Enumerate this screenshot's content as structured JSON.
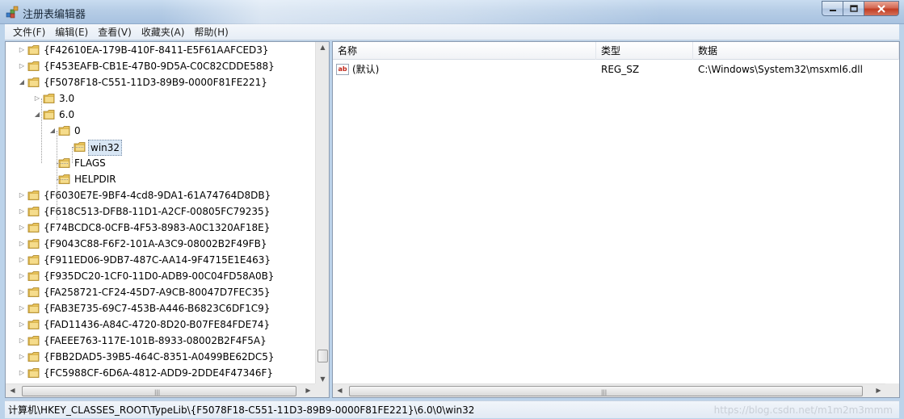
{
  "window": {
    "title": "注册表编辑器"
  },
  "menu": [
    "文件(F)",
    "编辑(E)",
    "查看(V)",
    "收藏夹(A)",
    "帮助(H)"
  ],
  "tree": [
    {
      "label": "{F42610EA-179B-410F-8411-E5F61AAFCED3}",
      "level": 0,
      "expander": "collapsed",
      "selected": false
    },
    {
      "label": "{F453EAFB-CB1E-47B0-9D5A-C0C82CDDE588}",
      "level": 0,
      "expander": "collapsed",
      "selected": false
    },
    {
      "label": "{F5078F18-C551-11D3-89B9-0000F81FE221}",
      "level": 0,
      "expander": "expanded",
      "selected": false
    },
    {
      "label": "3.0",
      "level": 1,
      "expander": "collapsed",
      "selected": false
    },
    {
      "label": "6.0",
      "level": 1,
      "expander": "expanded",
      "selected": false
    },
    {
      "label": "0",
      "level": 2,
      "expander": "expanded",
      "selected": false
    },
    {
      "label": "win32",
      "level": 3,
      "expander": "none",
      "selected": true
    },
    {
      "label": "FLAGS",
      "level": 2,
      "expander": "none",
      "selected": false
    },
    {
      "label": "HELPDIR",
      "level": 2,
      "expander": "none",
      "selected": false
    },
    {
      "label": "{F6030E7E-9BF4-4cd8-9DA1-61A74764D8DB}",
      "level": 0,
      "expander": "collapsed",
      "selected": false
    },
    {
      "label": "{F618C513-DFB8-11D1-A2CF-00805FC79235}",
      "level": 0,
      "expander": "collapsed",
      "selected": false
    },
    {
      "label": "{F74BCDC8-0CFB-4F53-8983-A0C1320AF18E}",
      "level": 0,
      "expander": "collapsed",
      "selected": false
    },
    {
      "label": "{F9043C88-F6F2-101A-A3C9-08002B2F49FB}",
      "level": 0,
      "expander": "collapsed",
      "selected": false
    },
    {
      "label": "{F911ED06-9DB7-487C-AA14-9F4715E1E463}",
      "level": 0,
      "expander": "collapsed",
      "selected": false
    },
    {
      "label": "{F935DC20-1CF0-11D0-ADB9-00C04FD58A0B}",
      "level": 0,
      "expander": "collapsed",
      "selected": false
    },
    {
      "label": "{FA258721-CF24-45D7-A9CB-80047D7FEC35}",
      "level": 0,
      "expander": "collapsed",
      "selected": false
    },
    {
      "label": "{FAB3E735-69C7-453B-A446-B6823C6DF1C9}",
      "level": 0,
      "expander": "collapsed",
      "selected": false
    },
    {
      "label": "{FAD11436-A84C-4720-8D20-B07FE84FDE74}",
      "level": 0,
      "expander": "collapsed",
      "selected": false
    },
    {
      "label": "{FAEEE763-117E-101B-8933-08002B2F4F5A}",
      "level": 0,
      "expander": "collapsed",
      "selected": false
    },
    {
      "label": "{FBB2DAD5-39B5-464C-8351-A0499BE62DC5}",
      "level": 0,
      "expander": "collapsed",
      "selected": false
    },
    {
      "label": "{FC5988CF-6D6A-4812-ADD9-2DDE4F47346F}",
      "level": 0,
      "expander": "collapsed",
      "selected": false
    }
  ],
  "list": {
    "columns": [
      "名称",
      "类型",
      "数据"
    ],
    "rows": [
      {
        "icon": "string-value-icon",
        "icon_text": "ab",
        "name": "(默认)",
        "type": "REG_SZ",
        "data": "C:\\Windows\\System32\\msxml6.dll"
      }
    ]
  },
  "statusbar": {
    "path": "计算机\\HKEY_CLASSES_ROOT\\TypeLib\\{F5078F18-C551-11D3-89B9-0000F81FE221}\\6.0\\0\\win32",
    "watermark": "https://blog.csdn.net/m1m2m3mmm"
  },
  "colors": {
    "folder": "#e8c35a",
    "selection": "#d9e7f5",
    "title_bar": "#b6cde6",
    "close_button": "#c23e24"
  }
}
